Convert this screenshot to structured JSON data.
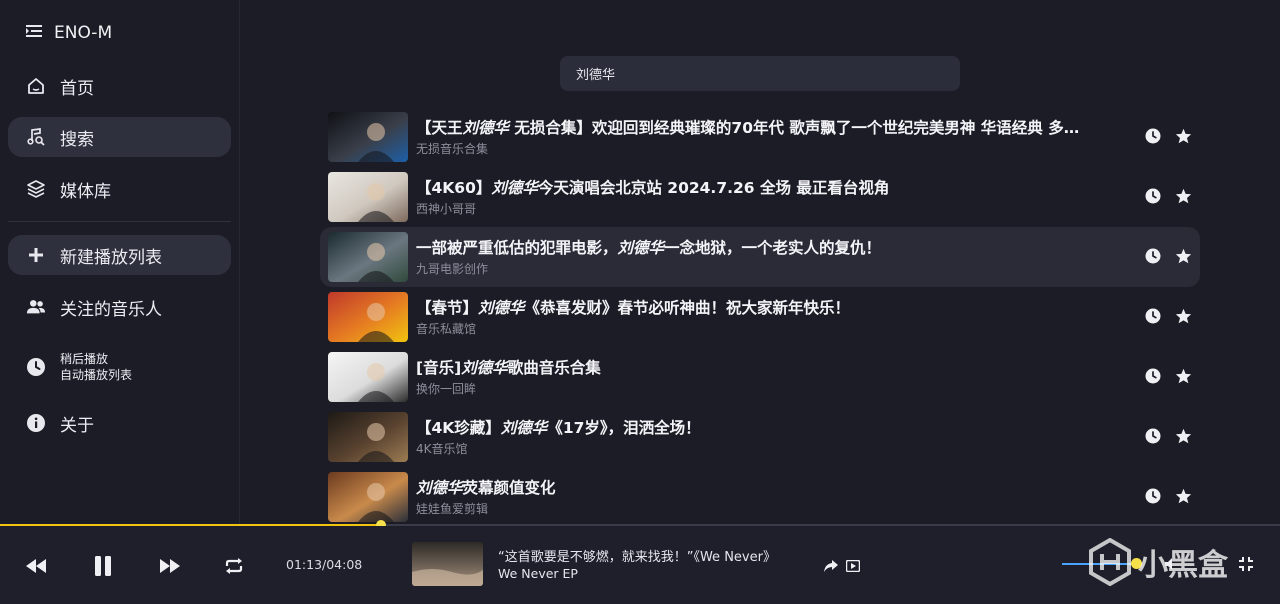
{
  "app": {
    "title": "ENO-M"
  },
  "sidebar": {
    "items": [
      {
        "key": "home",
        "label": "首页",
        "icon": "home-icon"
      },
      {
        "key": "search",
        "label": "搜索",
        "icon": "music-search-icon",
        "active": true
      },
      {
        "key": "library",
        "label": "媒体库",
        "icon": "layers-icon"
      }
    ],
    "new_playlist": {
      "label": "新建播放列表",
      "icon": "plus-icon"
    },
    "followed": {
      "label": "关注的音乐人",
      "icon": "users-icon"
    },
    "later": {
      "line1": "稍后播放",
      "line2": "自动播放列表",
      "icon": "clock-icon"
    },
    "about": {
      "label": "关于",
      "icon": "info-icon"
    }
  },
  "search": {
    "value": "刘德华"
  },
  "results": [
    {
      "pre": "【天王",
      "hl": "刘德华",
      "post": " 无损合集】欢迎回到经典璀璨的70年代 歌声飘了一个世纪完美男神 华语经典 多…",
      "sub": "无损音乐合集",
      "thumb_colors": [
        "#0f1115",
        "#3a3f4a",
        "#1d5fa8"
      ]
    },
    {
      "pre": "【4K60】",
      "hl": "刘德华",
      "post": "今天演唱会北京站 2024.7.26 全场 最正看台视角",
      "sub": "西神小哥哥",
      "thumb_colors": [
        "#e9e6e0",
        "#cfc8bf",
        "#7d6a5c"
      ]
    },
    {
      "pre": "一部被严重低估的犯罪电影，",
      "hl": "刘德华",
      "post": "一念地狱，一个老实人的复仇！",
      "sub": "九哥电影创作",
      "thumb_colors": [
        "#1a2a2f",
        "#6b7780",
        "#2f4a3c"
      ],
      "hover": true
    },
    {
      "pre": "【春节】",
      "hl": "刘德华",
      "post": "《恭喜发财》春节必听神曲！祝大家新年快乐！",
      "sub": "音乐私藏馆",
      "thumb_colors": [
        "#c0392b",
        "#e67e22",
        "#f1c40f"
      ]
    },
    {
      "pre": "[音乐]",
      "hl": "刘德华",
      "post": "歌曲音乐合集",
      "sub": "换你一回眸",
      "thumb_colors": [
        "#f5f5f5",
        "#dcdcdc",
        "#2b2b2b"
      ]
    },
    {
      "pre": "【4K珍藏】",
      "hl": "刘德华",
      "post": "《17岁》，泪洒全场！",
      "sub": "4K音乐馆",
      "thumb_colors": [
        "#1e1a16",
        "#5a4330",
        "#9c7c52"
      ]
    },
    {
      "pre": "",
      "hl": "刘德华",
      "post": "荧幕颜值变化",
      "sub": "娃娃鱼爱剪辑",
      "thumb_colors": [
        "#6b3a1f",
        "#c98a4b",
        "#2a2f3a"
      ]
    }
  ],
  "player": {
    "time": "01:13/04:08",
    "progress": 0.298,
    "now_playing": "“这首歌要是不够燃，就来找我！”《We Never》",
    "album": "We Never EP",
    "volume": 0.9,
    "watermark": "小黑盒"
  },
  "colors": {
    "accent": "#f1c40f",
    "background": "#1b1c25",
    "volume": "#4aa3ff"
  }
}
